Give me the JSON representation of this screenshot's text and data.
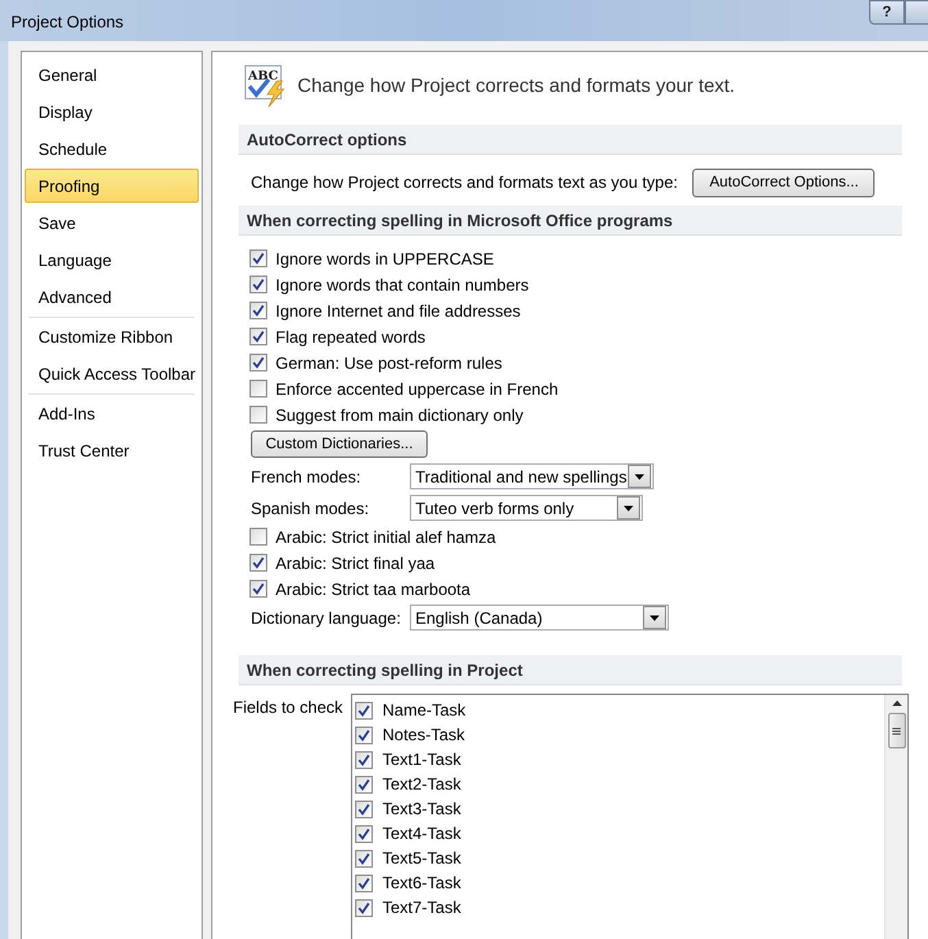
{
  "window": {
    "title": "Project Options",
    "help_button": "?"
  },
  "sidebar": {
    "groups": [
      [
        {
          "label": "General",
          "selected": false
        },
        {
          "label": "Display",
          "selected": false
        },
        {
          "label": "Schedule",
          "selected": false
        },
        {
          "label": "Proofing",
          "selected": true
        },
        {
          "label": "Save",
          "selected": false
        },
        {
          "label": "Language",
          "selected": false
        },
        {
          "label": "Advanced",
          "selected": false
        }
      ],
      [
        {
          "label": "Customize Ribbon",
          "selected": false
        },
        {
          "label": "Quick Access Toolbar",
          "selected": false
        }
      ],
      [
        {
          "label": "Add-Ins",
          "selected": false
        },
        {
          "label": "Trust Center",
          "selected": false
        }
      ]
    ]
  },
  "header": {
    "icon_text": "ABC",
    "text": "Change how Project corrects and formats your text."
  },
  "autocorrect": {
    "heading": "AutoCorrect options",
    "label": "Change how Project corrects and formats text as you type:",
    "button": "AutoCorrect Options..."
  },
  "office": {
    "heading": "When correcting spelling in Microsoft Office programs",
    "items": [
      {
        "kind": "checkbox",
        "label": "Ignore words in UPPERCASE",
        "checked": true
      },
      {
        "kind": "checkbox",
        "label": "Ignore words that contain numbers",
        "checked": true
      },
      {
        "kind": "checkbox",
        "label": "Ignore Internet and file addresses",
        "checked": true
      },
      {
        "kind": "checkbox",
        "label": "Flag repeated words",
        "checked": true
      },
      {
        "kind": "checkbox",
        "label": "German: Use post-reform rules",
        "checked": true
      },
      {
        "kind": "checkbox",
        "label": "Enforce accented uppercase in French",
        "checked": false
      },
      {
        "kind": "checkbox",
        "label": "Suggest from main dictionary only",
        "checked": false
      },
      {
        "kind": "button",
        "label": "Custom Dictionaries..."
      },
      {
        "kind": "dropdown",
        "label": "French modes:",
        "value": "Traditional and new spellings"
      },
      {
        "kind": "dropdown",
        "label": "Spanish modes:",
        "value": "Tuteo verb forms only"
      },
      {
        "kind": "checkbox",
        "label": "Arabic: Strict initial alef hamza",
        "checked": false
      },
      {
        "kind": "checkbox",
        "label": "Arabic: Strict final yaa",
        "checked": true
      },
      {
        "kind": "checkbox",
        "label": "Arabic: Strict taa marboota",
        "checked": true
      },
      {
        "kind": "dropdown",
        "label": "Dictionary language:",
        "value": "English (Canada)"
      }
    ]
  },
  "project": {
    "heading": "When correcting spelling in Project",
    "fields_label": "Fields to check",
    "fields": [
      {
        "label": "Name-Task",
        "checked": true
      },
      {
        "label": "Notes-Task",
        "checked": true
      },
      {
        "label": "Text1-Task",
        "checked": true
      },
      {
        "label": "Text2-Task",
        "checked": true
      },
      {
        "label": "Text3-Task",
        "checked": true
      },
      {
        "label": "Text4-Task",
        "checked": true
      },
      {
        "label": "Text5-Task",
        "checked": true
      },
      {
        "label": "Text6-Task",
        "checked": true
      },
      {
        "label": "Text7-Task",
        "checked": true
      }
    ]
  }
}
